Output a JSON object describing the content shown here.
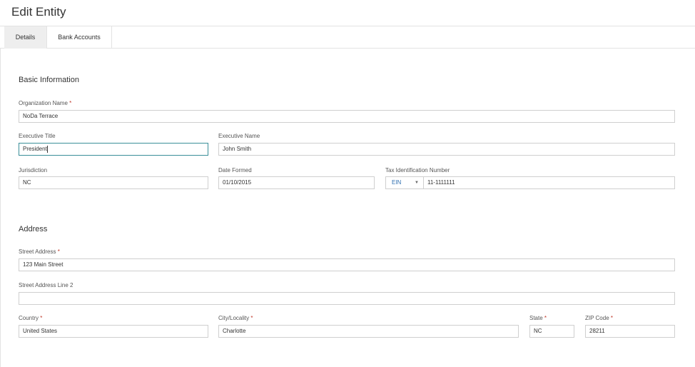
{
  "header": {
    "title": "Edit Entity"
  },
  "tabs": [
    {
      "label": "Details",
      "active": true
    },
    {
      "label": "Bank Accounts",
      "active": false
    }
  ],
  "basic": {
    "section_title": "Basic Information",
    "org_name": {
      "label": "Organization Name",
      "required_mark": "*",
      "value": "NoDa Terrace"
    },
    "exec_title": {
      "label": "Executive Title",
      "value": "President"
    },
    "exec_name": {
      "label": "Executive Name",
      "value": "John Smith"
    },
    "jurisdiction": {
      "label": "Jurisdiction",
      "value": "NC"
    },
    "date_formed": {
      "label": "Date Formed",
      "value": "01/10/2015"
    },
    "tax_id": {
      "label": "Tax Identification Number",
      "type": "EIN",
      "value": "11-1111111"
    }
  },
  "address": {
    "section_title": "Address",
    "street": {
      "label": "Street Address",
      "required_mark": "*",
      "value": "123 Main Street"
    },
    "street2": {
      "label": "Street Address Line 2",
      "value": ""
    },
    "country": {
      "label": "Country",
      "required_mark": "*",
      "value": "United States"
    },
    "city": {
      "label": "City/Locality",
      "required_mark": "*",
      "value": "Charlotte"
    },
    "state": {
      "label": "State",
      "required_mark": "*",
      "value": "NC"
    },
    "zip": {
      "label": "ZIP Code",
      "required_mark": "*",
      "value": "28211"
    }
  },
  "colors": {
    "focus_border": "#3a8f99",
    "required": "#c0392b",
    "link_blue": "#2f6fb0"
  }
}
